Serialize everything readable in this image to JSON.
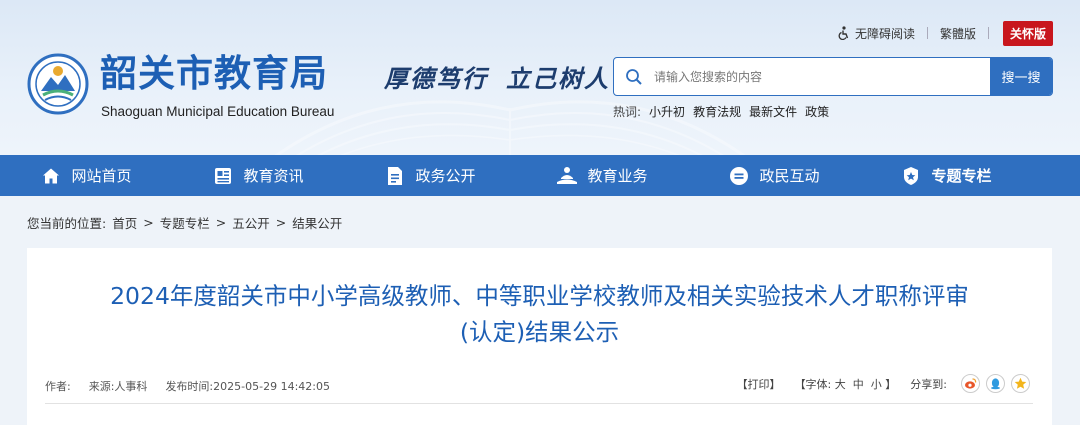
{
  "header": {
    "site_title": "韶关市教育局",
    "site_subtitle": "Shaoguan Municipal Education Bureau",
    "slogan_part1": "厚德笃行",
    "slogan_part2": "立己树人",
    "utility": {
      "accessibility": "无障碍阅读",
      "traditional": "繁體版",
      "care": "关怀版"
    },
    "search": {
      "placeholder": "请输入您搜索的内容",
      "button": "搜一搜"
    },
    "hot": {
      "label": "热词:",
      "words": [
        "小升初",
        "教育法规",
        "最新文件",
        "政策"
      ]
    }
  },
  "nav": {
    "items": [
      {
        "label": "网站首页",
        "icon": "home-icon"
      },
      {
        "label": "教育资讯",
        "icon": "news-icon"
      },
      {
        "label": "政务公开",
        "icon": "document-icon"
      },
      {
        "label": "教育业务",
        "icon": "service-icon"
      },
      {
        "label": "政民互动",
        "icon": "chat-icon"
      },
      {
        "label": "专题专栏",
        "icon": "badge-icon"
      }
    ],
    "active_index": 5
  },
  "breadcrumb": {
    "prefix": "您当前的位置:",
    "items": [
      "首页",
      "专题专栏",
      "五公开",
      "结果公开"
    ],
    "separator": ">"
  },
  "article": {
    "title_line1": "2024年度韶关市中小学高级教师、中等职业学校教师及相关实验技术人才职称评审",
    "title_line2": "(认定)结果公示",
    "meta": {
      "author_label": "作者:",
      "source": "来源:人事科",
      "publish_time": "发布时间:2025-05-29 14:42:05"
    },
    "tools": {
      "print": "【打印】",
      "font_prefix": "【字体:",
      "font_large": "大",
      "font_medium": "中",
      "font_small": "小",
      "font_suffix": "】",
      "share_label": "分享到:"
    }
  },
  "colors": {
    "primary": "#2f6fc0",
    "title": "#1d5fb4",
    "care": "#c8161d"
  }
}
